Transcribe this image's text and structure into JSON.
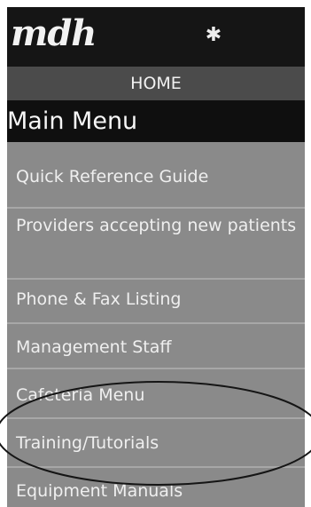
{
  "header": {
    "logo_text": "mdh",
    "star_icon_name": "star-icon",
    "home_label": "HOME",
    "main_menu_title": "Main Menu"
  },
  "menu": {
    "items": [
      {
        "label": "Quick Reference Guide"
      },
      {
        "label": "Providers accepting new patients"
      },
      {
        "label": "Phone & Fax Listing"
      },
      {
        "label": "Management Staff"
      },
      {
        "label": "Cafeteria Menu"
      },
      {
        "label": "Training/Tutorials"
      },
      {
        "label": "Equipment Manuals"
      }
    ],
    "highlighted_item": "Training/Tutorials"
  },
  "colors": {
    "panel_bg": "#8a8a8a",
    "header_bg": "#151515",
    "home_bg": "#4b4b4b",
    "main_menu_bg": "#0f0f0f",
    "text": "#efefef"
  }
}
